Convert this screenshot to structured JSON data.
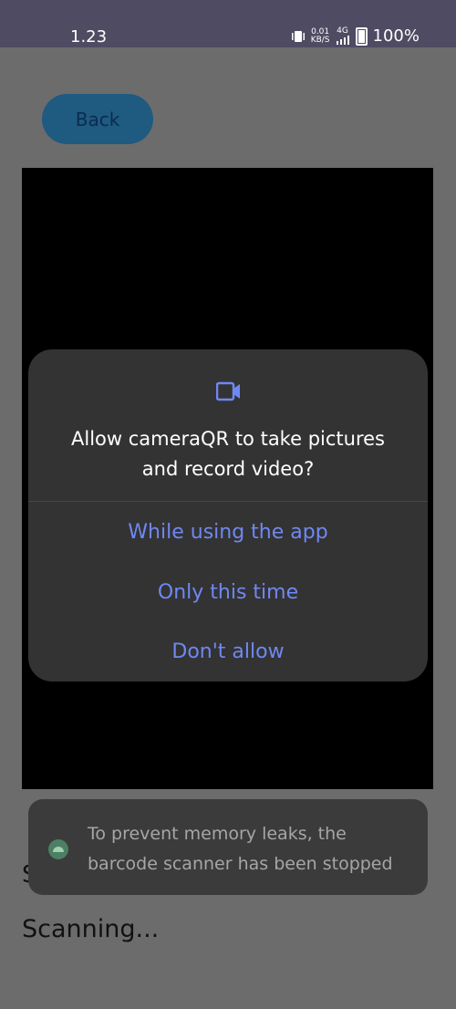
{
  "status_bar": {
    "time": "1.23",
    "net_speed_top": "0.01",
    "net_speed_bottom": "KB/S",
    "network_label": "4G",
    "battery": "100%"
  },
  "back_button": {
    "label": "Back"
  },
  "permission_dialog": {
    "icon": "video-camera-icon",
    "title": "Allow cameraQR to take pictures and record video?",
    "options": [
      "While using the app",
      "Only this time",
      "Don't allow"
    ]
  },
  "toast": {
    "message": "To prevent memory leaks, the barcode scanner has been stopped"
  },
  "scan_status": {
    "partial": "S",
    "status": "Scanning..."
  },
  "colors": {
    "status_bar": "#4f4b63",
    "dialog_bg": "#333333",
    "accent_text": "#6f88f2",
    "backdrop": "#6c6c6c"
  }
}
